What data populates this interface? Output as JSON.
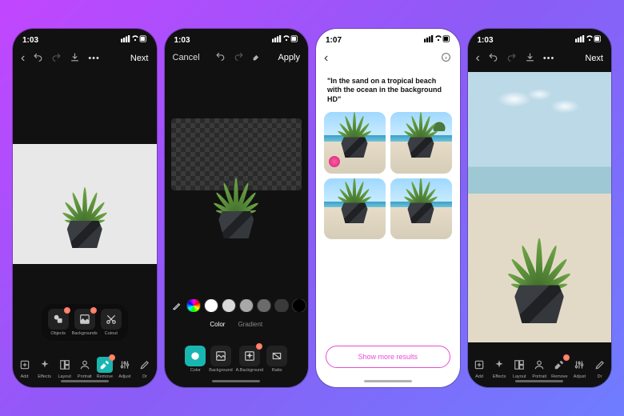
{
  "phone1": {
    "time": "1:03",
    "back": "‹",
    "next": "Next",
    "submenu": [
      {
        "label": "Objects",
        "badge": true
      },
      {
        "label": "Backgrounds",
        "badge": true
      },
      {
        "label": "Cutout",
        "badge": false
      }
    ],
    "tools": [
      "Add",
      "Effects",
      "Layout",
      "Portrait",
      "Remove",
      "Adjust",
      "Dr"
    ]
  },
  "phone2": {
    "time": "1:03",
    "cancel": "Cancel",
    "apply": "Apply",
    "swatches": [
      "#ffffff",
      "#d9d9d9",
      "#a8a8a8",
      "#6b6b6b",
      "#3a3a3a",
      "#000000",
      "#f2a6a0",
      "#ef8f8f"
    ],
    "tabs": [
      "Color",
      "Gradient"
    ],
    "bgtools": [
      "Color",
      "Background",
      "A.Background",
      "Ratio"
    ]
  },
  "phone3": {
    "time": "1:07",
    "prompt": "\"In the sand on a tropical beach with the ocean in the background HD\"",
    "showmore": "Show more results"
  },
  "phone4": {
    "time": "1:03",
    "next": "Next",
    "tools": [
      "Add",
      "Effects",
      "Layout",
      "Portrait",
      "Remove",
      "Adjust",
      "Dr"
    ]
  }
}
